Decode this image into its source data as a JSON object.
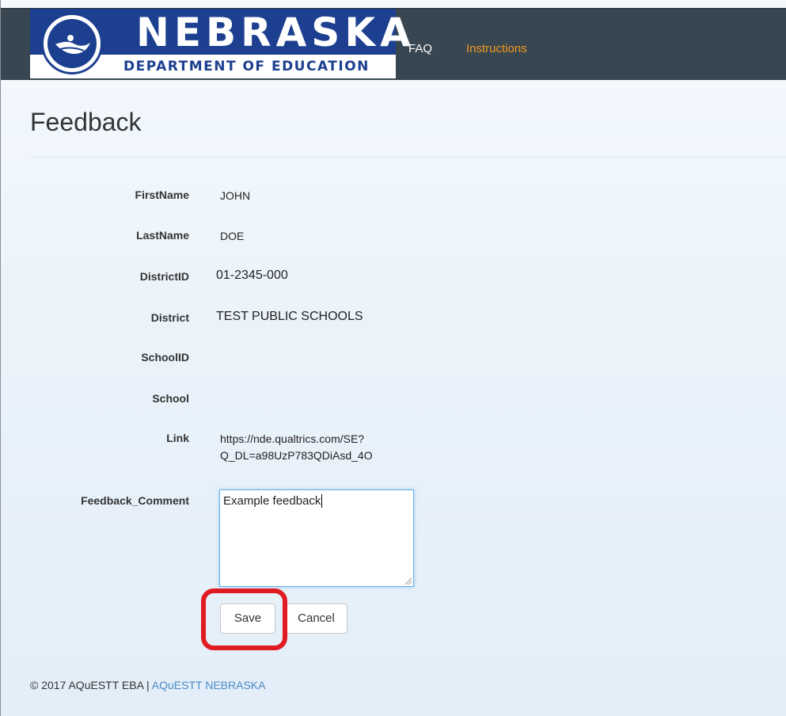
{
  "header": {
    "logo_word": "NEBRASKA",
    "logo_sub": "DEPARTMENT OF EDUCATION",
    "nav": [
      {
        "label": "FAQ"
      },
      {
        "label": "Instructions"
      }
    ]
  },
  "page": {
    "title": "Feedback"
  },
  "form": {
    "fields": [
      {
        "label": "FirstName",
        "value": "JOHN"
      },
      {
        "label": "LastName",
        "value": "DOE"
      },
      {
        "label": "DistrictID",
        "value": "01-2345-000"
      },
      {
        "label": "District",
        "value": "TEST PUBLIC SCHOOLS"
      },
      {
        "label": "SchoolID",
        "value": ""
      },
      {
        "label": "School",
        "value": ""
      }
    ],
    "link": {
      "label": "Link",
      "line1": "https://nde.qualtrics.com/SE?",
      "line2": "Q_DL=a98UzP783QDiAsd_4O"
    },
    "comment": {
      "label": "Feedback_Comment",
      "value": "Example feedback"
    },
    "save_label": "Save",
    "cancel_label": "Cancel"
  },
  "footer": {
    "copyright": "© 2017 AQuESTT EBA | ",
    "link_label": "AQuESTT NEBRASKA"
  },
  "colors": {
    "header_bg": "#384651",
    "logo_blue": "#1c3f8f",
    "instructions_orange": "#f39a1e",
    "highlight_red": "#e11b22",
    "footer_link": "#4a8ac6"
  }
}
